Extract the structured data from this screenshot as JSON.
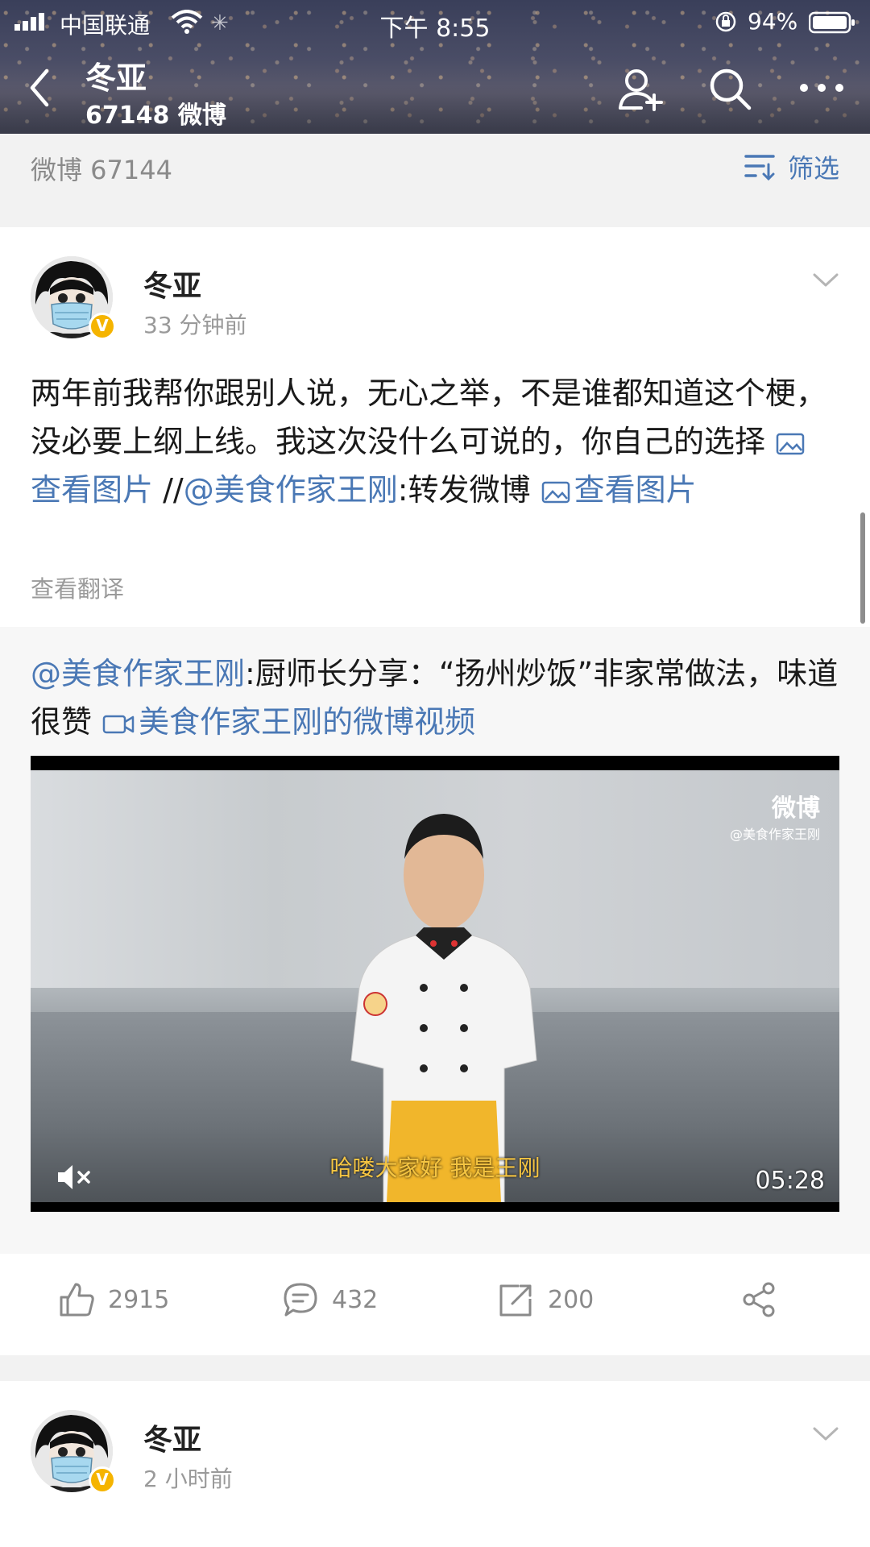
{
  "status_bar": {
    "carrier": "中国联通",
    "time": "下午 8:55",
    "battery": "94%"
  },
  "nav": {
    "title": "冬亚",
    "weibo_count": "67148 微博"
  },
  "filter_bar": {
    "label": "微博 67144",
    "filter_label": "筛选"
  },
  "posts": [
    {
      "author": "冬亚",
      "time": "33 分钟前",
      "text_main": "两年前我帮你跟别人说，无心之举，不是谁都知道这个梗，没必要上纲上线。我这次没什么可说的，你自己的选择 ",
      "view_image_1": "查看图片",
      "separator": " //",
      "mention": "@美食作家王刚",
      "repost_text": ":转发微博 ",
      "view_image_2": "查看图片",
      "translate": "查看翻译",
      "repost": {
        "mention": "@美食作家王刚",
        "text": ":厨师长分享：“扬州炒饭”非家常做法，味道很赞 ",
        "video_link": "美食作家王刚的微博视频"
      },
      "video": {
        "watermark_brand": "微博",
        "watermark_handle": "@美食作家王刚",
        "subtitle": "哈喽大家好  我是王刚",
        "duration": "05:28"
      },
      "actions": {
        "likes": "2915",
        "comments": "432",
        "reposts": "200"
      }
    },
    {
      "author": "冬亚",
      "time": "2 小时前"
    }
  ]
}
